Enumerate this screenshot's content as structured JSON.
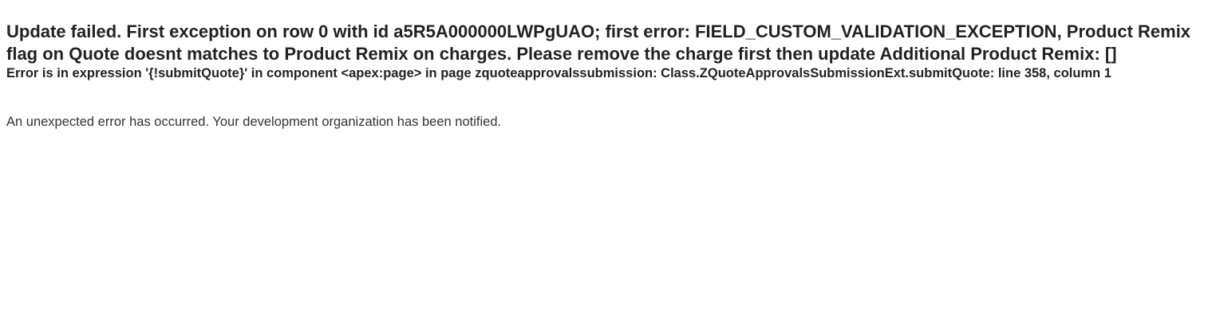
{
  "error": {
    "headline": "Update failed. First exception on row 0 with id a5R5A000000LWPgUAO; first error: FIELD_CUSTOM_VALIDATION_EXCEPTION, Product Remix flag on Quote doesnt matches to Product Remix on charges. Please remove the charge first then update Additional Product Remix: []",
    "detail": "Error is in expression '{!submitQuote}' in component <apex:page> in page zquoteapprovalssubmission: Class.ZQuoteApprovalsSubmissionExt.submitQuote: line 358, column 1",
    "notice": "An unexpected error has occurred. Your development organization has been notified."
  }
}
